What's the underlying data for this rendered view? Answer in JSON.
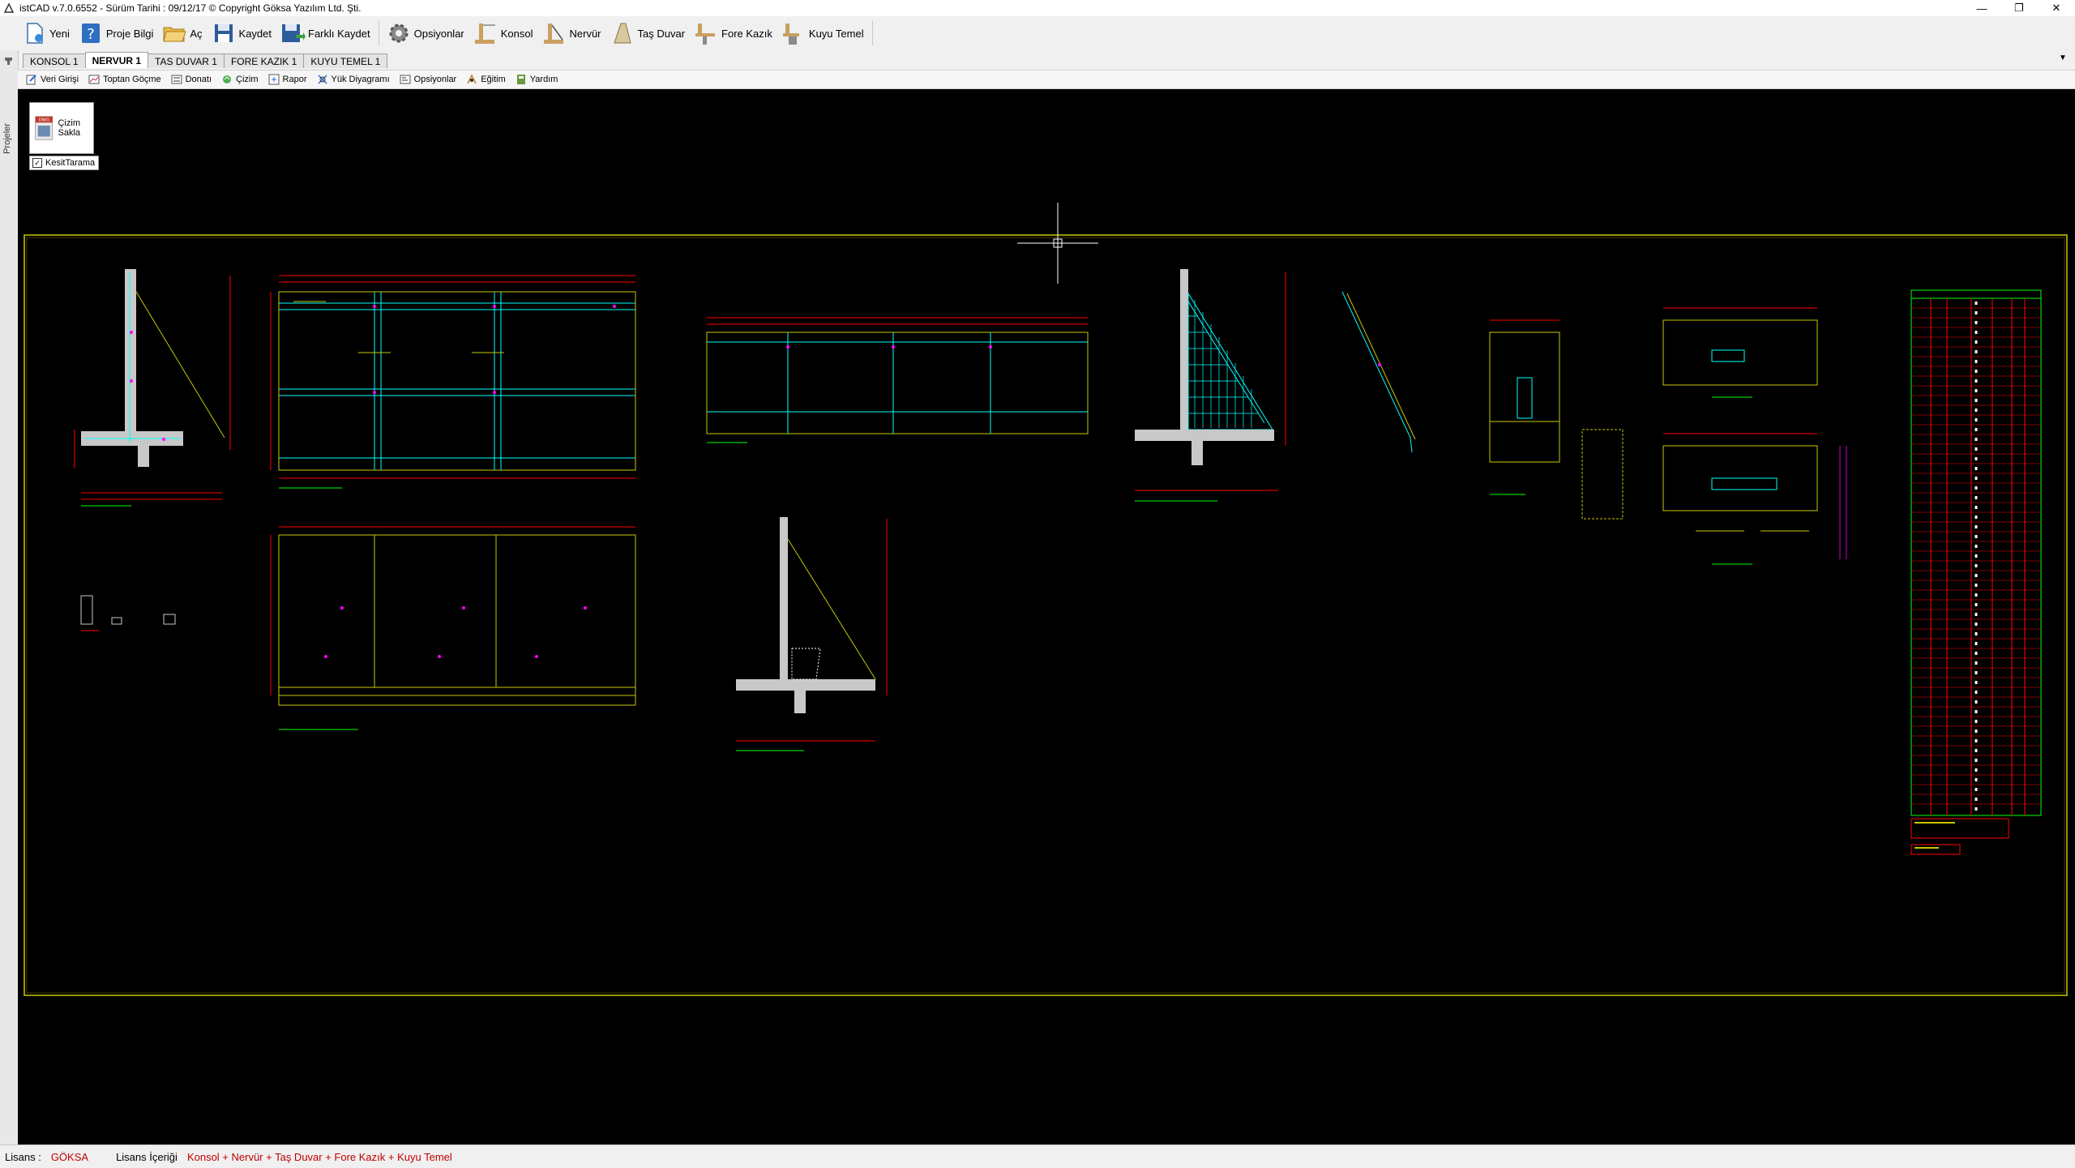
{
  "window": {
    "title": "istCAD v.7.0.6552 -  Sürüm Tarihi : 09/12/17  © Copyright Göksa Yazılım Ltd. Şti.",
    "minimize": "—",
    "restore": "❐",
    "close": "✕"
  },
  "toolbar": {
    "items": [
      {
        "label": "Yeni",
        "icon": "new-file-icon"
      },
      {
        "label": "Proje Bilgi",
        "icon": "help-icon"
      },
      {
        "label": "Aç",
        "icon": "open-folder-icon"
      },
      {
        "label": "Kaydet",
        "icon": "save-icon"
      },
      {
        "label": "Farklı Kaydet",
        "icon": "save-as-icon"
      },
      {
        "label": "Opsiyonlar",
        "icon": "gear-icon"
      },
      {
        "label": "Konsol",
        "icon": "konsol-wall-icon"
      },
      {
        "label": "Nervür",
        "icon": "nervur-wall-icon"
      },
      {
        "label": "Taş Duvar",
        "icon": "stone-wall-icon"
      },
      {
        "label": "Fore Kazık",
        "icon": "bored-pile-icon"
      },
      {
        "label": "Kuyu Temel",
        "icon": "well-foundation-icon"
      }
    ]
  },
  "side_panel": {
    "label": "Projeler"
  },
  "tabs": [
    {
      "label": "KONSOL 1",
      "active": false
    },
    {
      "label": "NERVUR 1",
      "active": true
    },
    {
      "label": "TAS DUVAR 1",
      "active": false
    },
    {
      "label": "FORE KAZIK 1",
      "active": false
    },
    {
      "label": "KUYU TEMEL 1",
      "active": false
    }
  ],
  "tab_dropdown": "▼",
  "subtoolbar": {
    "items": [
      {
        "label": "Veri Girişi",
        "icon": "data-entry-icon"
      },
      {
        "label": "Toptan Göçme",
        "icon": "collapse-icon"
      },
      {
        "label": "Donatı",
        "icon": "rebar-icon"
      },
      {
        "label": "Çizim",
        "icon": "drawing-icon"
      },
      {
        "label": "Rapor",
        "icon": "report-icon"
      },
      {
        "label": "Yük Diyagramı",
        "icon": "load-diagram-icon"
      },
      {
        "label": "Opsiyonlar",
        "icon": "options-icon"
      },
      {
        "label": "Eğitim",
        "icon": "training-icon"
      },
      {
        "label": "Yardım",
        "icon": "help-book-icon"
      }
    ]
  },
  "canvas": {
    "hide_drawing_label": "Çizim Sakla",
    "dwg_icon_text": "DWG",
    "section_hatch_label": "KesitTarama",
    "section_hatch_checked": "✓"
  },
  "status": {
    "license_label": "Lisans :",
    "license_value": "GÖKSA",
    "content_label": "Lisans İçeriği",
    "content_value": "Konsol + Nervür + Taş Duvar + Fore Kazık + Kuyu Temel"
  },
  "colors": {
    "canvas_bg": "#000000",
    "frame": "#c8c800",
    "rebar_cyan": "#00ffff",
    "dimension_red": "#ff0000",
    "label_green": "#00ff00",
    "marker_magenta": "#ff00ff",
    "concrete": "#c8c8c8",
    "status_value": "#c00000"
  }
}
